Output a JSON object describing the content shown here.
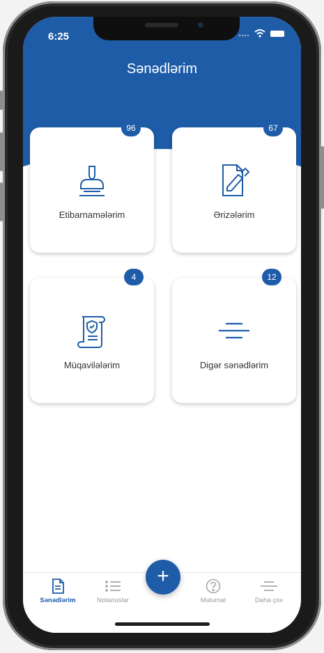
{
  "status_bar": {
    "time": "6:25"
  },
  "header": {
    "title": "Sənədlərim"
  },
  "cards": [
    {
      "label": "Etibarnamələrim",
      "badge": "96",
      "icon": "stamp-icon"
    },
    {
      "label": "Ərizələrim",
      "badge": "67",
      "icon": "document-edit-icon"
    },
    {
      "label": "Müqavilələrim",
      "badge": "4",
      "icon": "contract-scroll-icon"
    },
    {
      "label": "Digər sənədlərim",
      "badge": "12",
      "icon": "lines-icon"
    }
  ],
  "fab": {
    "label": "+",
    "icon": "plus-icon"
  },
  "tabbar": {
    "items": [
      {
        "label": "Sənədlərim",
        "icon": "document-icon",
        "active": true
      },
      {
        "label": "Notariuslar",
        "icon": "list-icon",
        "active": false
      },
      {
        "label": "Məlumat",
        "icon": "help-circle-icon",
        "active": false
      },
      {
        "label": "Daha çox",
        "icon": "menu-lines-icon",
        "active": false
      }
    ]
  },
  "colors": {
    "primary": "#1e5ca8",
    "background": "#ffffff",
    "text": "#333333",
    "muted": "#9a9a9a"
  }
}
